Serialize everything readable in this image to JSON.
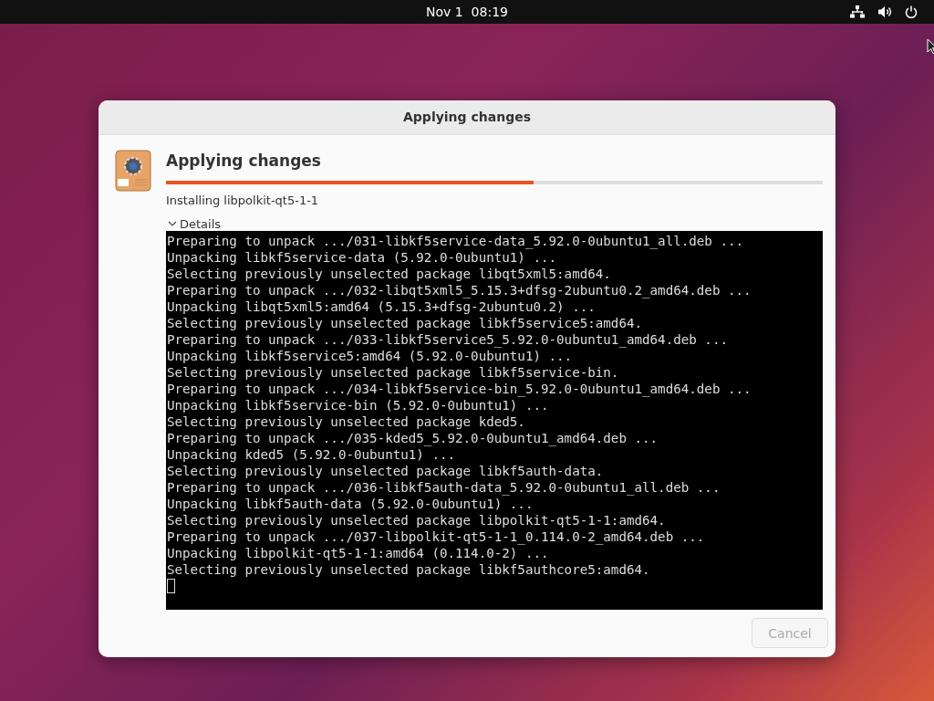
{
  "top_bar": {
    "clock": "Nov 1  08:19"
  },
  "dialog": {
    "title": "Applying changes",
    "heading": "Applying changes",
    "progress": {
      "level": 0.56
    },
    "status": "Installing libpolkit-qt5-1-1",
    "details": {
      "label": "Details",
      "expanded": true
    },
    "terminal_lines": [
      "Preparing to unpack .../031-libkf5service-data_5.92.0-0ubuntu1_all.deb ...",
      "Unpacking libkf5service-data (5.92.0-0ubuntu1) ...",
      "Selecting previously unselected package libqt5xml5:amd64.",
      "Preparing to unpack .../032-libqt5xml5_5.15.3+dfsg-2ubuntu0.2_amd64.deb ...",
      "Unpacking libqt5xml5:amd64 (5.15.3+dfsg-2ubuntu0.2) ...",
      "Selecting previously unselected package libkf5service5:amd64.",
      "Preparing to unpack .../033-libkf5service5_5.92.0-0ubuntu1_amd64.deb ...",
      "Unpacking libkf5service5:amd64 (5.92.0-0ubuntu1) ...",
      "Selecting previously unselected package libkf5service-bin.",
      "Preparing to unpack .../034-libkf5service-bin_5.92.0-0ubuntu1_amd64.deb ...",
      "Unpacking libkf5service-bin (5.92.0-0ubuntu1) ...",
      "Selecting previously unselected package kded5.",
      "Preparing to unpack .../035-kded5_5.92.0-0ubuntu1_amd64.deb ...",
      "Unpacking kded5 (5.92.0-0ubuntu1) ...",
      "Selecting previously unselected package libkf5auth-data.",
      "Preparing to unpack .../036-libkf5auth-data_5.92.0-0ubuntu1_all.deb ...",
      "Unpacking libkf5auth-data (5.92.0-0ubuntu1) ...",
      "Selecting previously unselected package libpolkit-qt5-1-1:amd64.",
      "Preparing to unpack .../037-libpolkit-qt5-1-1_0.114.0-2_amd64.deb ...",
      "Unpacking libpolkit-qt5-1-1:amd64 (0.114.0-2) ...",
      "Selecting previously unselected package libkf5authcore5:amd64."
    ],
    "cancel_button": {
      "label": "Cancel",
      "disabled": true
    }
  }
}
